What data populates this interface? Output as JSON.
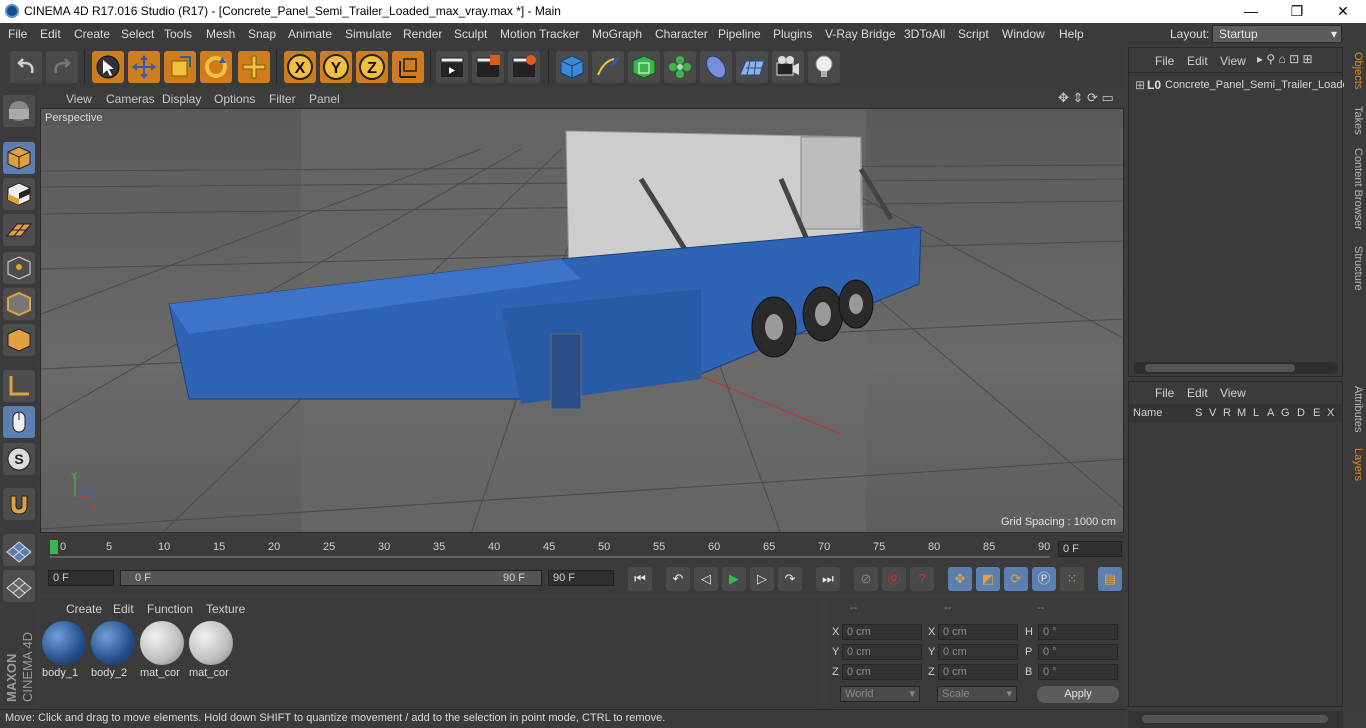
{
  "window": {
    "title": "CINEMA 4D R17.016 Studio (R17) - [Concrete_Panel_Semi_Trailer_Loaded_max_vray.max *] - Main",
    "min": "—",
    "max": "❐",
    "close": "✕"
  },
  "menubar": {
    "items": [
      "File",
      "Edit",
      "Create",
      "Select",
      "Tools",
      "Mesh",
      "Snap",
      "Animate",
      "Simulate",
      "Render",
      "Sculpt",
      "Motion Tracker",
      "MoGraph",
      "Character",
      "Pipeline",
      "Plugins",
      "V-Ray Bridge",
      "3DToAll",
      "Script",
      "Window",
      "Help"
    ],
    "layout_label": "Layout:",
    "layout_value": "Startup"
  },
  "viewport": {
    "menu": [
      "View",
      "Cameras",
      "Display",
      "Options",
      "Filter",
      "Panel"
    ],
    "camera_label": "Perspective",
    "grid_spacing": "Grid Spacing : 1000 cm",
    "axis_labels": {
      "y": "Y",
      "x": "X",
      "z": "Z"
    }
  },
  "timeline": {
    "ticks": [
      "0",
      "5",
      "10",
      "15",
      "20",
      "25",
      "30",
      "35",
      "40",
      "45",
      "50",
      "55",
      "60",
      "65",
      "70",
      "75",
      "80",
      "85",
      "90"
    ],
    "current_frame": "0 F"
  },
  "transport": {
    "start": "0 F",
    "range_start": "0 F",
    "range_end": "90 F",
    "end": "90 F"
  },
  "materials": {
    "menu": [
      "Create",
      "Edit",
      "Function",
      "Texture"
    ],
    "items": [
      {
        "name": "body_1"
      },
      {
        "name": "body_2"
      },
      {
        "name": "mat_cor"
      },
      {
        "name": "mat_cor"
      }
    ]
  },
  "coords": {
    "headers": [
      "--",
      "--",
      "--"
    ],
    "rows": [
      {
        "l1": "X",
        "v1": "0 cm",
        "l2": "X",
        "v2": "0 cm",
        "l3": "H",
        "v3": "0 °"
      },
      {
        "l1": "Y",
        "v1": "0 cm",
        "l2": "Y",
        "v2": "0 cm",
        "l3": "P",
        "v3": "0 °"
      },
      {
        "l1": "Z",
        "v1": "0 cm",
        "l2": "Z",
        "v2": "0 cm",
        "l3": "B",
        "v3": "0 °"
      }
    ],
    "mode1": "World",
    "mode2": "Scale",
    "apply": "Apply"
  },
  "objects_panel": {
    "menu": [
      "File",
      "Edit",
      "View"
    ],
    "object_name": "Concrete_Panel_Semi_Trailer_Loaded"
  },
  "attributes_panel": {
    "menu": [
      "File",
      "Edit",
      "View"
    ],
    "columns": [
      "Name",
      "S",
      "V",
      "R",
      "M",
      "L",
      "A",
      "G",
      "D",
      "E",
      "X"
    ]
  },
  "right_tabs": [
    "Objects",
    "Takes",
    "Content Browser",
    "Structure",
    "Attributes",
    "Layers"
  ],
  "status": "Move: Click and drag to move elements. Hold down SHIFT to quantize movement / add to the selection in point mode, CTRL to remove.",
  "brand": {
    "maxon": "MAXON",
    "cinema": "CINEMA 4D"
  }
}
